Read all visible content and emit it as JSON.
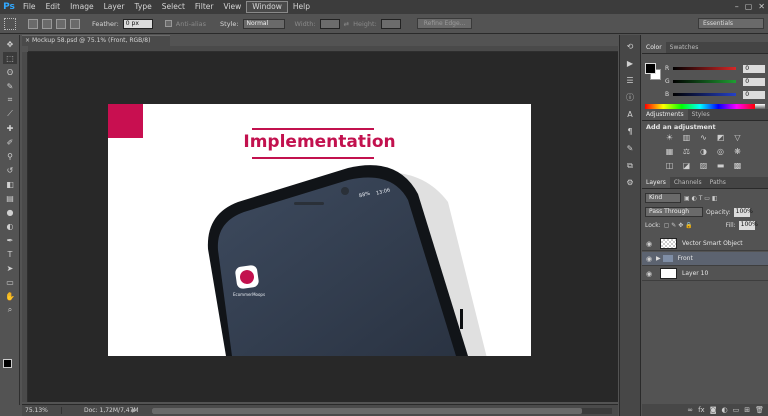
{
  "app": {
    "logo": "Ps"
  },
  "menu": [
    "File",
    "Edit",
    "Image",
    "Layer",
    "Type",
    "Select",
    "Filter",
    "View",
    "Window",
    "Help"
  ],
  "window_controls": [
    "–",
    "▢",
    "✕"
  ],
  "options": {
    "feather_label": "Feather:",
    "feather_value": "0 px",
    "antialias_label": "Anti-alias",
    "style_label": "Style:",
    "style_value": "Normal",
    "width_label": "Width:",
    "height_label": "Height:",
    "refine_edge": "Refine Edge...",
    "workspace": "Essentials"
  },
  "document": {
    "tab_title": "Mockup 58.psd @ 75.1% (Front, RGB/8)",
    "close_glyph": "×",
    "slide_title": "Implementation",
    "accent_color": "#c2114e",
    "phone": {
      "status_battery": "88%",
      "status_time": "13:06",
      "app_label": "EcommerMoops"
    }
  },
  "status": {
    "zoom": "75.13%",
    "doc": "Doc: 1,72M/7,47M",
    "arrow": "▶"
  },
  "tools": [
    "move-icon",
    "marquee-icon",
    "lasso-icon",
    "quick-select-icon",
    "crop-icon",
    "eyedropper-icon",
    "healing-icon",
    "brush-icon",
    "clone-stamp-icon",
    "history-brush-icon",
    "eraser-icon",
    "gradient-icon",
    "blur-icon",
    "dodge-icon",
    "pen-icon",
    "type-icon",
    "path-select-icon",
    "shape-icon",
    "hand-icon",
    "zoom-icon"
  ],
  "panels": {
    "color_tabs": [
      "Color",
      "Swatches"
    ],
    "channels": [
      {
        "label": "R",
        "value": "0",
        "color": "#d62828"
      },
      {
        "label": "G",
        "value": "0",
        "color": "#1f9e32"
      },
      {
        "label": "B",
        "value": "0",
        "color": "#2541c7"
      }
    ],
    "adjust_tabs": [
      "Adjustments",
      "Styles"
    ],
    "adjust_title": "Add an adjustment",
    "layers_tabs": [
      "Layers",
      "Channels",
      "Paths"
    ],
    "kind": "Kind",
    "blend_mode": "Pass Through",
    "opacity_label": "Opacity:",
    "opacity": "100%",
    "lock_label": "Lock:",
    "fill_label": "Fill:",
    "fill": "100%",
    "layers": [
      {
        "name": "Vector Smart Object",
        "type": "smart",
        "selected": false
      },
      {
        "name": "Front",
        "type": "group",
        "selected": true
      },
      {
        "name": "Layer 10",
        "type": "layer",
        "selected": false
      }
    ]
  }
}
